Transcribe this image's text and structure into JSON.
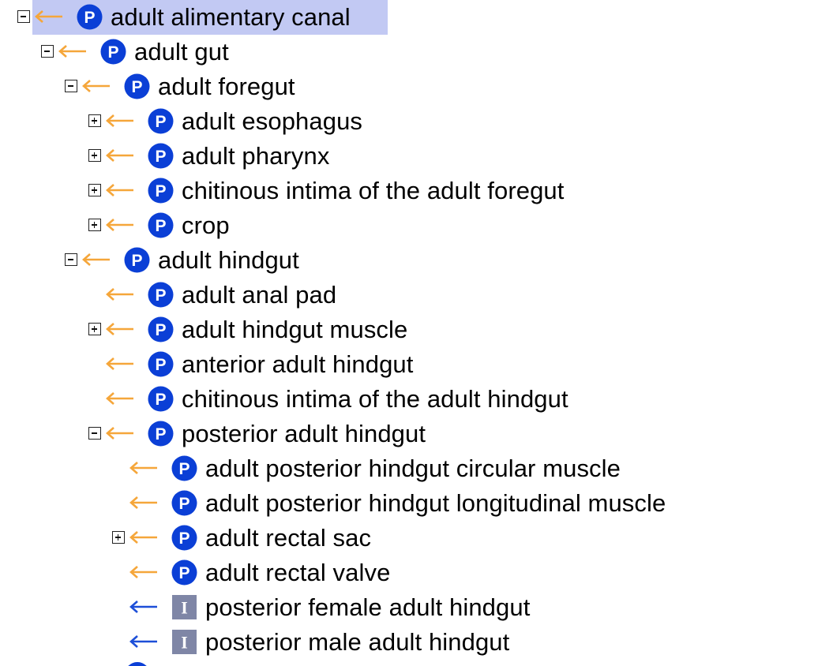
{
  "tree": {
    "selected_label": "adult alimentary canal",
    "nodes": [
      {
        "label": "adult alimentary canal",
        "depth": 0,
        "toggle": "minus",
        "arrow": "orange",
        "badge": "P",
        "selected": true
      },
      {
        "label": "adult gut",
        "depth": 1,
        "toggle": "minus",
        "arrow": "orange",
        "badge": "P"
      },
      {
        "label": "adult foregut",
        "depth": 2,
        "toggle": "minus",
        "arrow": "orange",
        "badge": "P"
      },
      {
        "label": "adult esophagus",
        "depth": 3,
        "toggle": "plus",
        "arrow": "orange",
        "badge": "P"
      },
      {
        "label": "adult pharynx",
        "depth": 3,
        "toggle": "plus",
        "arrow": "orange",
        "badge": "P"
      },
      {
        "label": "chitinous intima of the adult foregut",
        "depth": 3,
        "toggle": "plus",
        "arrow": "orange",
        "badge": "P"
      },
      {
        "label": "crop",
        "depth": 3,
        "toggle": "plus",
        "arrow": "orange",
        "badge": "P"
      },
      {
        "label": "adult hindgut",
        "depth": 2,
        "toggle": "minus",
        "arrow": "orange",
        "badge": "P"
      },
      {
        "label": "adult anal pad",
        "depth": 3,
        "toggle": "none",
        "arrow": "orange",
        "badge": "P"
      },
      {
        "label": "adult hindgut muscle",
        "depth": 3,
        "toggle": "plus",
        "arrow": "orange",
        "badge": "P"
      },
      {
        "label": "anterior adult hindgut",
        "depth": 3,
        "toggle": "none",
        "arrow": "orange",
        "badge": "P"
      },
      {
        "label": "chitinous intima of the adult hindgut",
        "depth": 3,
        "toggle": "none",
        "arrow": "orange",
        "badge": "P"
      },
      {
        "label": "posterior adult hindgut",
        "depth": 3,
        "toggle": "minus",
        "arrow": "orange",
        "badge": "P"
      },
      {
        "label": "adult posterior hindgut circular muscle",
        "depth": 4,
        "toggle": "none",
        "arrow": "orange",
        "badge": "P"
      },
      {
        "label": "adult posterior hindgut longitudinal muscle",
        "depth": 4,
        "toggle": "none",
        "arrow": "orange",
        "badge": "P"
      },
      {
        "label": "adult rectal sac",
        "depth": 4,
        "toggle": "plus",
        "arrow": "orange",
        "badge": "P"
      },
      {
        "label": "adult rectal valve",
        "depth": 4,
        "toggle": "none",
        "arrow": "orange",
        "badge": "P"
      },
      {
        "label": "posterior female adult hindgut",
        "depth": 4,
        "toggle": "none",
        "arrow": "blue",
        "badge": "I"
      },
      {
        "label": "posterior male adult hindgut",
        "depth": 4,
        "toggle": "none",
        "arrow": "blue",
        "badge": "I"
      }
    ]
  },
  "colors": {
    "selection": "#c2c9f3",
    "orange_arrow": "#f5a63a",
    "blue_arrow": "#1d4fd8",
    "p_badge": "#0b3fd6",
    "i_badge": "#7f86a6",
    "text": "#000000"
  },
  "icons": {
    "expand": "plus-box-icon",
    "collapse": "minus-box-icon",
    "part_of_arrow": "left-arrow-icon",
    "part_badge": "p-circle-icon",
    "instance_badge": "i-square-icon"
  }
}
